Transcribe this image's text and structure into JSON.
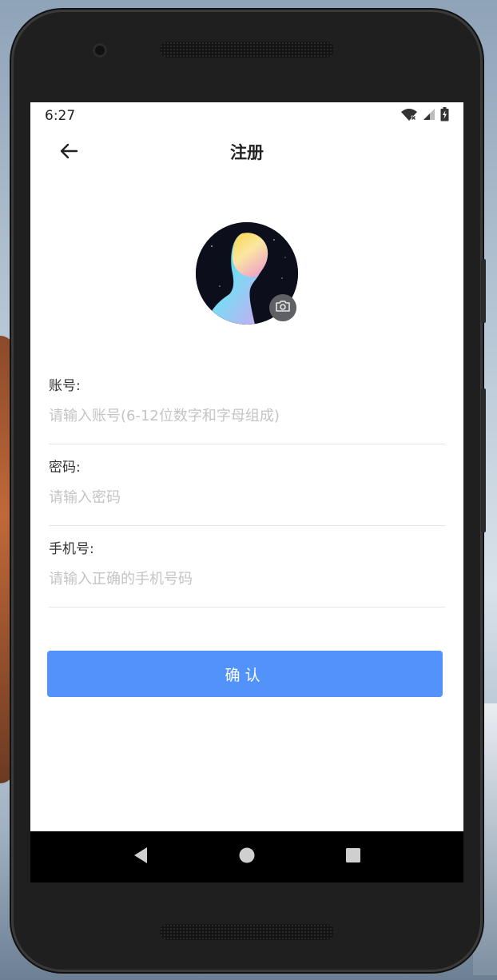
{
  "status_bar": {
    "time": "6:27",
    "icons": [
      "wifi-off-icon",
      "signal-icon",
      "battery-charging-icon"
    ]
  },
  "toolbar": {
    "back_icon": "arrow-left-icon",
    "title": "注册"
  },
  "avatar": {
    "badge_icon": "camera-icon"
  },
  "form": {
    "account": {
      "label": "账号:",
      "value": "",
      "placeholder": "请输入账号(6-12位数字和字母组成)"
    },
    "password": {
      "label": "密码:",
      "value": "",
      "placeholder": "请输入密码"
    },
    "phone": {
      "label": "手机号:",
      "value": "",
      "placeholder": "请输入正确的手机号码"
    }
  },
  "confirm_button": {
    "label": "确认",
    "color": "#5193fb"
  },
  "nav_bar": {
    "buttons": [
      "back-triangle-icon",
      "home-circle-icon",
      "recents-square-icon"
    ]
  }
}
